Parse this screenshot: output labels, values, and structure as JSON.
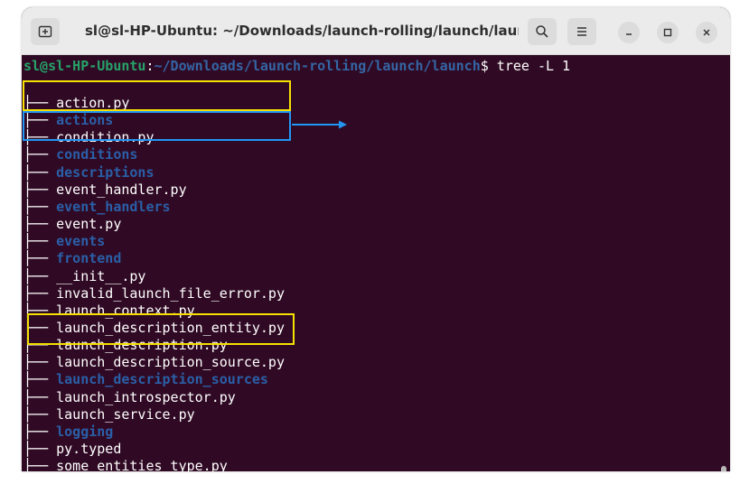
{
  "window": {
    "title": "sl@sl-HP-Ubuntu: ~/Downloads/launch-rolling/launch/launch"
  },
  "titlebar_icons": {
    "new_tab": "new-tab-icon",
    "search": "search-icon",
    "menu": "hamburger-menu-icon",
    "minimize": "minimize-icon",
    "maximize": "maximize-icon",
    "close": "close-icon"
  },
  "terminal": {
    "prompt": {
      "user_host": "sl@sl-HP-Ubuntu",
      "colon": ":",
      "path": "~/Downloads/launch-rolling/launch/launch",
      "dollar": "$ ",
      "command": "tree -L 1"
    },
    "tree_prefix": "├── ",
    "entries": [
      {
        "name": "action.py",
        "type": "file"
      },
      {
        "name": "actions",
        "type": "dir"
      },
      {
        "name": "condition.py",
        "type": "file"
      },
      {
        "name": "conditions",
        "type": "dir"
      },
      {
        "name": "descriptions",
        "type": "dir"
      },
      {
        "name": "event_handler.py",
        "type": "file"
      },
      {
        "name": "event_handlers",
        "type": "dir"
      },
      {
        "name": "event.py",
        "type": "file"
      },
      {
        "name": "events",
        "type": "dir"
      },
      {
        "name": "frontend",
        "type": "dir"
      },
      {
        "name": "__init__.py",
        "type": "file"
      },
      {
        "name": "invalid_launch_file_error.py",
        "type": "file"
      },
      {
        "name": "launch_context.py",
        "type": "file"
      },
      {
        "name": "launch_description_entity.py",
        "type": "file"
      },
      {
        "name": "launch_description.py",
        "type": "file"
      },
      {
        "name": "launch_description_source.py",
        "type": "file"
      },
      {
        "name": "launch_description_sources",
        "type": "dir"
      },
      {
        "name": "launch_introspector.py",
        "type": "file"
      },
      {
        "name": "launch_service.py",
        "type": "file"
      },
      {
        "name": "logging",
        "type": "dir"
      },
      {
        "name": "py.typed",
        "type": "file"
      },
      {
        "name": "some_entities_type.py",
        "type": "file"
      }
    ]
  },
  "colors": {
    "terminal_bg": "#300a24",
    "prompt_user": "#26a269",
    "prompt_path": "#3465a4",
    "directory": "#2a5fa8",
    "highlight_yellow": "#f5e000",
    "highlight_blue": "#2196f3"
  }
}
